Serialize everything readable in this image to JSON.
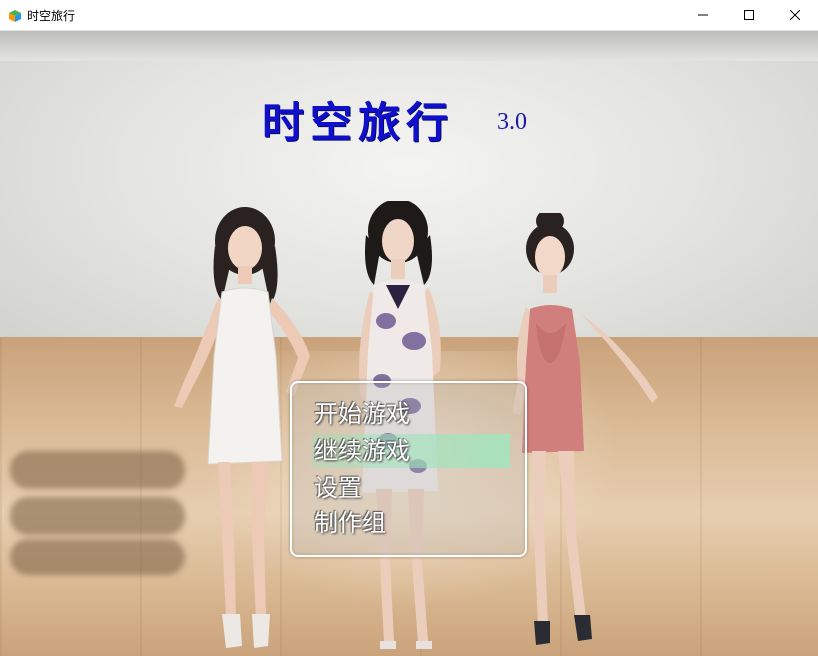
{
  "window": {
    "title": "时空旅行"
  },
  "game": {
    "title": "时空旅行",
    "version": "3.0"
  },
  "menu": {
    "items": [
      {
        "label": "开始游戏",
        "selected": false
      },
      {
        "label": "继续游戏",
        "selected": true
      },
      {
        "label": "设置",
        "selected": false
      },
      {
        "label": "制作组",
        "selected": false
      }
    ],
    "highlight_color": "#a8e6c2"
  },
  "colors": {
    "title_color": "#1010cc",
    "titlebar_bg": "#ffffff"
  },
  "icons": {
    "app": "app-cube-icon",
    "minimize": "minimize-icon",
    "maximize": "maximize-icon",
    "close": "close-icon"
  }
}
